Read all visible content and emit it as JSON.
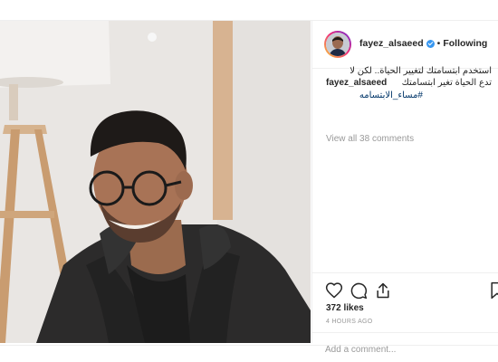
{
  "post": {
    "username": "fayez_alsaeed",
    "separator": "•",
    "follow_label": "Following",
    "caption": {
      "user": "fayez_alsaeed",
      "line1": "استخدم ابتسامتك لتغيير الحياة.. لكن لا",
      "line2": "تدع الحياة تغير ابتسامتك",
      "hashtag": "#مساء_الابتسامه"
    },
    "view_comments": "View all 38 comments",
    "likes": "372 likes",
    "time_ago": "4 HOURS AGO",
    "comment_placeholder": "Add a comment..."
  },
  "icons": {
    "like": "heart-icon",
    "comment": "comment-icon",
    "share": "share-icon",
    "save": "bookmark-icon",
    "verified": "verified-badge-icon"
  },
  "colors": {
    "text": "#262626",
    "muted": "#999999",
    "hashtag": "#003569",
    "verified": "#3897f0"
  }
}
